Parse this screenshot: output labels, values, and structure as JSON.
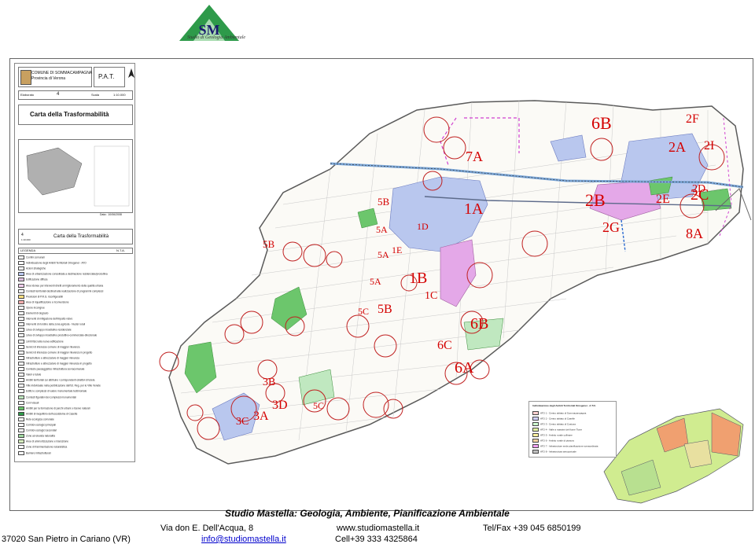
{
  "logo": {
    "initials": "SM",
    "subtitle": "Studio di Geologia Ambientale",
    "color": "#2e9a4a"
  },
  "legend_panel": {
    "comune": "COMUNE DI SOMMACAMPAGNA",
    "provincia": "Provincia di Verona",
    "doc_type": "P.A.T.",
    "elaborato_label": "Elaborato",
    "elaborato_num": "4",
    "scala_label": "Scala",
    "scala_value": "1:10.000",
    "title": "Carta della Trasformabilità",
    "date_label": "Data : 10/06/2008",
    "tavola_num": "4",
    "tavola_scale": "1:10.000",
    "tavola_title": "Carta della Trasformabilità",
    "legenda_label": "LEGENDA",
    "nta_label": "N.T.A.",
    "rows": [
      {
        "text": "Confini comunali",
        "color": "#ffffff"
      },
      {
        "text": "Individuazione degli Ambiti Territoriali Omogenei - ATO",
        "color": "#ffffff"
      },
      {
        "text": "Azioni strategiche",
        "color": "#ffffff"
      },
      {
        "text": "Aree di urbanizzazione consolidata a destinazione residenziale/produttiva",
        "color": "#b9c7ee"
      },
      {
        "text": "Edificazione diffusa",
        "color": "#e0c0e0"
      },
      {
        "text": "Aree idonee per interventi diretti al miglioramento della qualità urbana",
        "color": "#f5d0f0"
      },
      {
        "text": "Contesti territoriali destinati alla realizzazione di programmi complessi",
        "color": "#ffffff"
      },
      {
        "text": "Previsioni di P.R.G. riconfigurabili",
        "color": "#ffe080"
      },
      {
        "text": "Aree di riqualificazione e riconversione",
        "color": "#ffb0b0"
      },
      {
        "text": "Opere incongrue",
        "color": "#ffffff"
      },
      {
        "text": "Elementi di degrado",
        "color": "#ffffff"
      },
      {
        "text": "Interventi di mitigazione dell'impatto visivo",
        "color": "#ffffff"
      },
      {
        "text": "Interventi di riordino della zona agricola - Nuclei rurali",
        "color": "#ffffff"
      },
      {
        "text": "Linee di sviluppo insediativo residenziale",
        "color": "#ffffff"
      },
      {
        "text": "Linee di sviluppo insediativo produttivo-commerciale-direzionale",
        "color": "#ffffff"
      },
      {
        "text": "Limiti fisici alla nuova edificazione",
        "color": "#ffffff"
      },
      {
        "text": "Servizi di interesse comune di maggior rilevanza",
        "color": "#ffffff"
      },
      {
        "text": "Servizi di interesse comune di maggior rilevanza in progetto",
        "color": "#ffffff"
      },
      {
        "text": "Infrastrutture e attrezzature di maggior rilevanza",
        "color": "#ffffff"
      },
      {
        "text": "Infrastrutture e attrezzature di maggior rilevanza in progetto",
        "color": "#ffffff"
      },
      {
        "text": "Contesto paesaggistico infrastruttura sovracomunale",
        "color": "#ffffff"
      },
      {
        "text": "Valori e tutele",
        "color": "#ffffff"
      },
      {
        "text": "Ambiti territoriali cui attribuire i corrispondenti obiettivi di tutela",
        "color": "#ffffff"
      },
      {
        "text": "Ville individuate nella pubblicazione dell'Ist. Reg. per le Ville Venete",
        "color": "#ffffff"
      },
      {
        "text": "Edifici e complessi di valore monumentale testimoniale",
        "color": "#ffffff"
      },
      {
        "text": "Contesti figurativi dei complessi monumentali",
        "color": "#c0e8c0"
      },
      {
        "text": "Coni visuali",
        "color": "#ffffff"
      },
      {
        "text": "Ambiti per la formazione di parchi urbani o riserve naturali",
        "color": "#6cc66c"
      },
      {
        "text": "Ambiti di riequilibrio dell'ecosistema di Casette",
        "color": "#2e9a4a"
      },
      {
        "text": "Rete ecologica comunale",
        "color": "#ffffff"
      },
      {
        "text": "Corridoi ecologici principali",
        "color": "#ffffff"
      },
      {
        "text": "Corridoi ecologici secondari",
        "color": "#ffffff"
      },
      {
        "text": "Zone ad elevata naturalità",
        "color": "#a0d8a0"
      },
      {
        "text": "Aree di ammortizzazione e transizione",
        "color": "#d8f0c0"
      },
      {
        "text": "Zone di frammentazione naturalistica",
        "color": "#ffffff"
      },
      {
        "text": "Barriere infrastrutturali",
        "color": "#ffffff"
      }
    ]
  },
  "ato_labels": [
    {
      "text": "6B",
      "size": 22
    },
    {
      "text": "2F",
      "size": 16
    },
    {
      "text": "2A",
      "size": 18
    },
    {
      "text": "2I",
      "size": 16
    },
    {
      "text": "7A",
      "size": 18
    },
    {
      "text": "2B",
      "size": 22
    },
    {
      "text": "2E",
      "size": 16
    },
    {
      "text": "2D",
      "size": 14
    },
    {
      "text": "2C",
      "size": 20
    },
    {
      "text": "1A",
      "size": 20
    },
    {
      "text": "5B",
      "size": 13
    },
    {
      "text": "2G",
      "size": 18
    },
    {
      "text": "8A",
      "size": 18
    },
    {
      "text": "5A",
      "size": 12
    },
    {
      "text": "1D",
      "size": 12
    },
    {
      "text": "5B",
      "size": 13
    },
    {
      "text": "1E",
      "size": 12
    },
    {
      "text": "5A",
      "size": 12
    },
    {
      "text": "1B",
      "size": 20
    },
    {
      "text": "5A",
      "size": 12
    },
    {
      "text": "1C",
      "size": 14
    },
    {
      "text": "5C",
      "size": 12
    },
    {
      "text": "5B",
      "size": 16
    },
    {
      "text": "6B",
      "size": 20
    },
    {
      "text": "6C",
      "size": 16
    },
    {
      "text": "6A",
      "size": 20
    },
    {
      "text": "3B",
      "size": 14
    },
    {
      "text": "3D",
      "size": 16
    },
    {
      "text": "5C",
      "size": 12
    },
    {
      "text": "3A",
      "size": 16
    },
    {
      "text": "3C",
      "size": 14
    }
  ],
  "right_legend": {
    "title": "Individuazione degli Ambiti Territoriali Omogenei - A.T.O.",
    "rows": [
      {
        "text": "ATO 1 - Centro abitato di Sommacampagna",
        "color": "#ffd0d0"
      },
      {
        "text": "ATO 2 - Centro abitato di Caselle",
        "color": "#d0d0ff"
      },
      {
        "text": "ATO 3 - Centro abitato di Custoza",
        "color": "#d0ffd0"
      },
      {
        "text": "ATO 4 - Valle a massimi del fiume Tione",
        "color": "#e0f0a0"
      },
      {
        "text": "ATO 5 - Ambito rurale collinare",
        "color": "#fff0a0"
      },
      {
        "text": "ATO 6 - Ambito rurale di pianura",
        "color": "#f0d0a0"
      },
      {
        "text": "ATO 7 - Infrastrutture sede pianificazione sovraordinata",
        "color": "#f0a0f0"
      },
      {
        "text": "ATO 8 - Infrastruttura aeroportuale",
        "color": "#c0c0c0"
      }
    ]
  },
  "footer": {
    "studio_name": "Studio Mastella: Geologia, Ambiente, Pianificazione Ambientale",
    "address": "Via don E. Dell'Acqua, 8",
    "website": "www.studiomastella.it",
    "tel_fax": "Tel/Fax  +39 045 6850199",
    "city": "37020 San Pietro in Cariano (VR)",
    "email": "info@studiomastella.it",
    "cell": "Cell+39 333 4325864"
  }
}
